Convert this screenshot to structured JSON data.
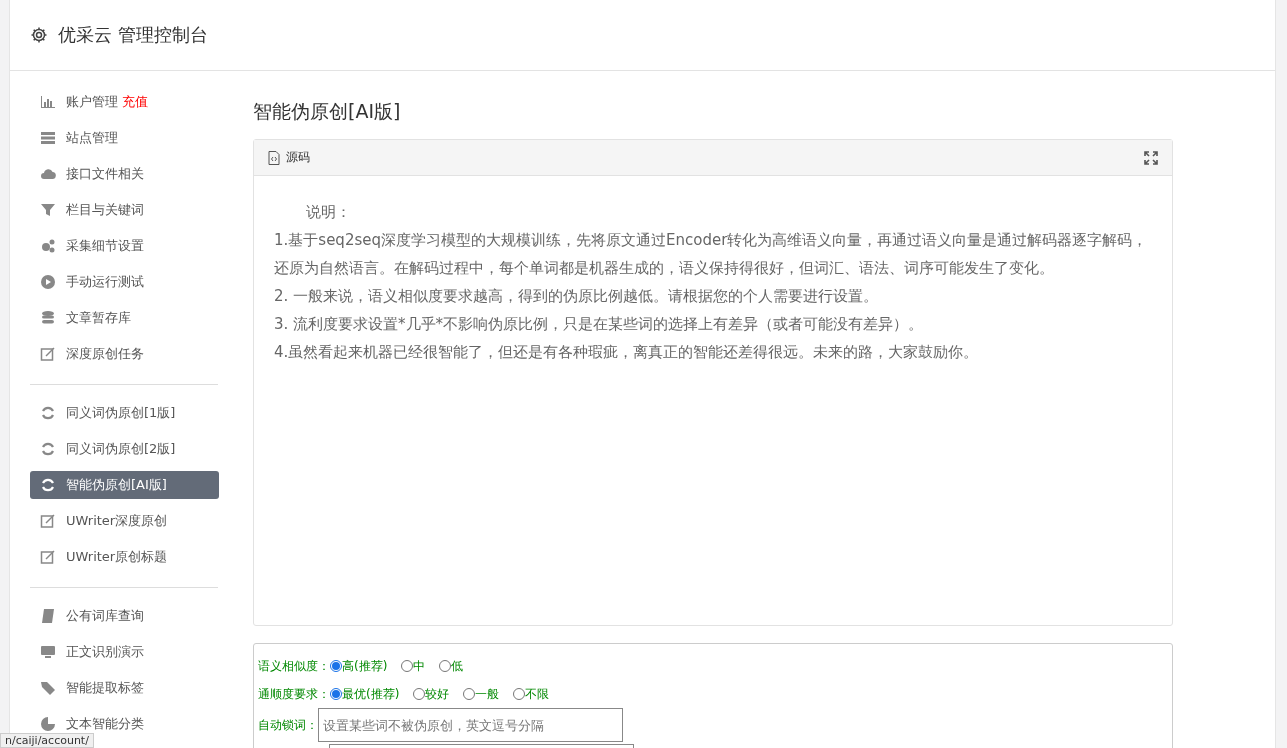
{
  "header": {
    "title": "优采云 管理控制台"
  },
  "sidebar": {
    "groups": [
      [
        {
          "label": "账户管理",
          "badge": "充值",
          "selected": false
        },
        {
          "label": "站点管理",
          "selected": false
        },
        {
          "label": "接口文件相关",
          "selected": false
        },
        {
          "label": "栏目与关键词",
          "selected": false
        },
        {
          "label": "采集细节设置",
          "selected": false
        },
        {
          "label": "手动运行测试",
          "selected": false
        },
        {
          "label": "文章暂存库",
          "selected": false
        },
        {
          "label": "深度原创任务",
          "selected": false
        }
      ],
      [
        {
          "label": "同义词伪原创[1版]",
          "selected": false
        },
        {
          "label": "同义词伪原创[2版]",
          "selected": false
        },
        {
          "label": "智能伪原创[AI版]",
          "selected": true
        },
        {
          "label": "UWriter深度原创",
          "selected": false
        },
        {
          "label": "UWriter原创标题",
          "selected": false
        }
      ],
      [
        {
          "label": "公有词库查询",
          "selected": false
        },
        {
          "label": "正文识别演示",
          "selected": false
        },
        {
          "label": "智能提取标签",
          "selected": false
        },
        {
          "label": "文本智能分类",
          "selected": false
        }
      ]
    ]
  },
  "page_title": "智能伪原创[AI版]",
  "panel": {
    "title": "源码",
    "heading": "说明：",
    "lines": [
      "1.基于seq2seq深度学习模型的大规模训练，先将原文通过Encoder转化为高维语义向量，再通过语义向量是通过解码器逐字解码，还原为自然语言。在解码过程中，每个单词都是机器生成的，语义保持得很好，但词汇、语法、词序可能发生了变化。",
      "2. 一般来说，语义相似度要求越高，得到的伪原比例越低。请根据您的个人需要进行设置。",
      "3. 流利度要求设置*几乎*不影响伪原比例，只是在某些词的选择上有差异（或者可能没有差异）。",
      "4.虽然看起来机器已经很智能了，但还是有各种瑕疵，离真正的智能还差得很远。未来的路，大家鼓励你。"
    ]
  },
  "form": {
    "rows": [
      {
        "kind": "radio",
        "label": "语义相似度：",
        "options": [
          {
            "label": "高(推荐)",
            "selected": true
          },
          {
            "label": "中",
            "selected": false
          },
          {
            "label": "低",
            "selected": false
          }
        ]
      },
      {
        "kind": "radio",
        "label": "通顺度要求：",
        "options": [
          {
            "label": "最优(推荐)",
            "selected": true
          },
          {
            "label": "较好",
            "selected": false
          },
          {
            "label": "一般",
            "selected": false
          },
          {
            "label": "不限",
            "selected": false
          }
        ]
      },
      {
        "kind": "text",
        "label": "自动锁词：",
        "placeholder": "设置某些词不被伪原创，英文逗号分隔"
      }
    ]
  },
  "status_url": "n/caiji/account/"
}
